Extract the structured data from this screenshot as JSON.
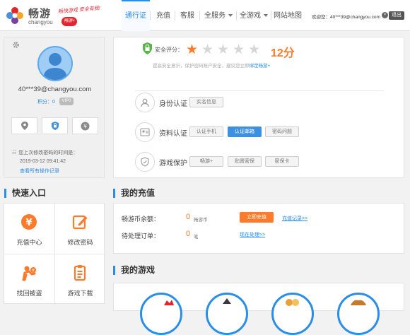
{
  "brand": {
    "name_cn": "畅游",
    "name_en": "changyou",
    "slogan": "畅快游戏 安全有我!",
    "plus": "畅游+"
  },
  "nav": {
    "items": [
      {
        "label": "通行证",
        "active": true
      },
      {
        "label": "充值"
      },
      {
        "label": "客服"
      },
      {
        "label": "全服务"
      },
      {
        "label": "全游戏"
      },
      {
        "label": "网站地图"
      }
    ],
    "welcome": "欢迎您：40***39@changyou.com",
    "logout": "退出"
  },
  "profile": {
    "email": "40***39@changyou.com",
    "points": "积分：0",
    "vip": "VIP0",
    "pwd_note": "您上次修改密码的时间是：",
    "pwd_date": "2019-03-12 09:41:42",
    "ops_link": "查看所有操作记录"
  },
  "security": {
    "score_label": "安全评分：",
    "stars_filled": 1,
    "stars_total": 5,
    "score": "12分",
    "hint": "提高安全意识，保护密码账户安全，建议您立即",
    "hint_link": "绑定畅游+",
    "rows": [
      {
        "label": "身份认证",
        "chips": [
          "实名信息"
        ]
      },
      {
        "label": "资料认证",
        "chips": [
          "认证手机",
          "认证邮箱",
          "密码问题"
        ]
      },
      {
        "label": "游戏保护",
        "chips": [
          "畅游+",
          "贴膏密保",
          "密保卡"
        ]
      }
    ]
  },
  "quick": {
    "title": "快速入口",
    "items": [
      {
        "label": "充值中心",
        "icon": "yen-circle-icon"
      },
      {
        "label": "修改密码",
        "icon": "edit-icon"
      },
      {
        "label": "找回被盗",
        "icon": "thief-icon"
      },
      {
        "label": "游戏下载",
        "icon": "download-list-icon"
      }
    ]
  },
  "charge": {
    "title": "我的充值",
    "balance_label": "畅游币余额：",
    "balance": "0",
    "balance_unit": "畅游币",
    "recharge_btn": "立即充值",
    "record_link": "充值记录>>",
    "pending_label": "待处理订单：",
    "pending": "0",
    "pending_unit": "笔",
    "process_link": "现在处理>>"
  },
  "games": {
    "title": "我的游戏"
  },
  "colors": {
    "accent": "#2b8ee6",
    "orange": "#ff7a2a",
    "brand_red": "#e3262d"
  }
}
